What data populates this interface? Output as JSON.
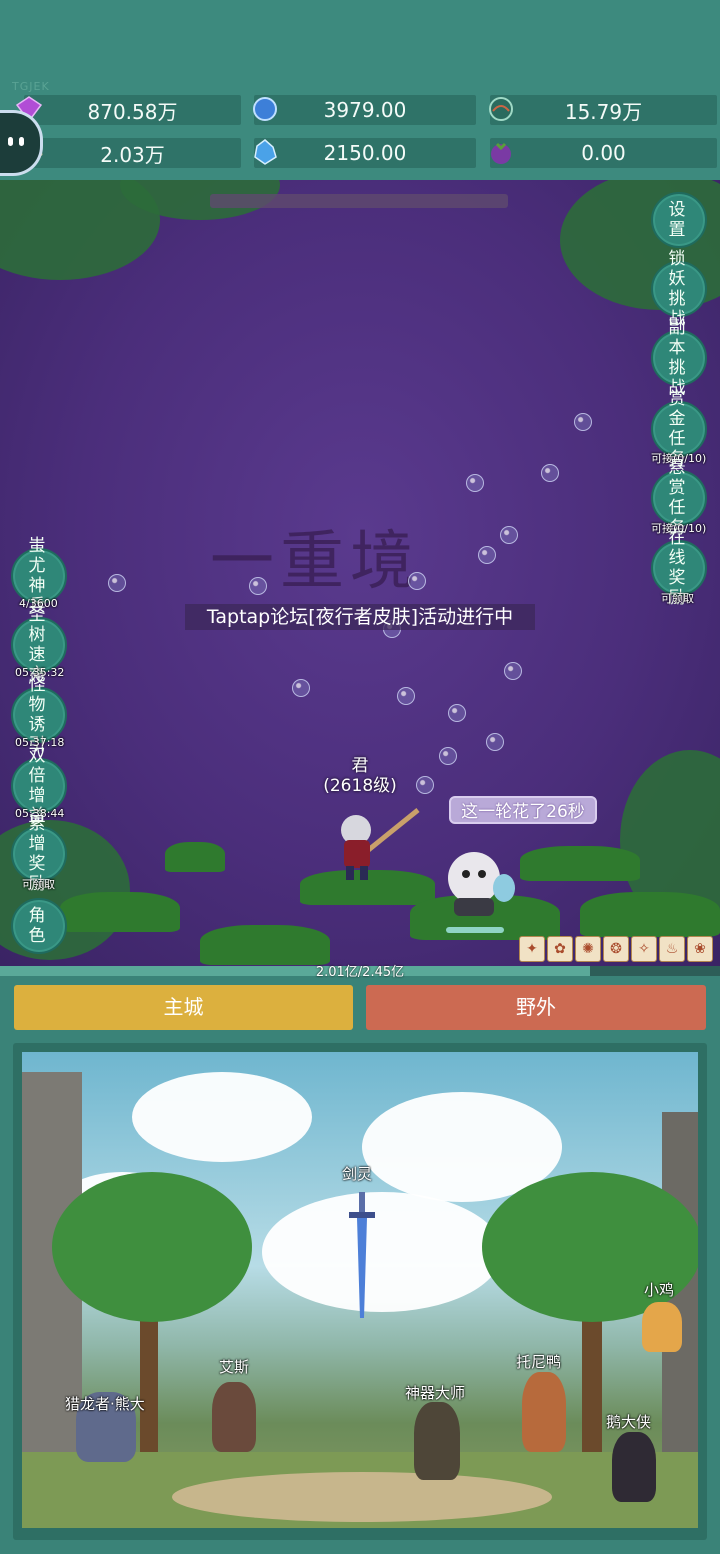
{
  "watermark": "TGJEK",
  "resources": [
    {
      "icon": "purple-gem-icon",
      "value": "870.58万"
    },
    {
      "icon": "blue-crystal-icon",
      "value": "3979.00"
    },
    {
      "icon": "orb-icon",
      "value": "15.79万"
    },
    {
      "icon": "scroll-icon",
      "value": "2.03万"
    },
    {
      "icon": "ice-crystal-icon",
      "value": "2150.00"
    },
    {
      "icon": "berry-icon",
      "value": "0.00"
    }
  ],
  "battle": {
    "background_text": "一重境",
    "announcement": "Taptap论坛[夜行者皮肤]活动进行中",
    "hero_name": "君",
    "hero_level": "(2618级)",
    "round_time": "这一轮花了26秒",
    "hp_text": "2.01亿/2.45亿",
    "hp_fraction": 0.82
  },
  "right_buttons": [
    {
      "label": "设置",
      "sub": ""
    },
    {
      "label": "锁妖挑战",
      "sub": ""
    },
    {
      "label": "副本挑战",
      "sub": ""
    },
    {
      "label": "赏金任务",
      "sub": "可接(0/10)"
    },
    {
      "label": "悬赏任务",
      "sub": "可接(0/10)"
    },
    {
      "label": "在线奖励",
      "sub": "可领取"
    }
  ],
  "left_buttons": [
    {
      "label": "蚩尤神兵",
      "sub": "4/3600"
    },
    {
      "label": "圣树速充",
      "sub": "05:35:32"
    },
    {
      "label": "怪物诱引",
      "sub": "05:37:18"
    },
    {
      "label": "双倍增益",
      "sub": "05:38:44"
    },
    {
      "label": "累增奖励",
      "sub": "可领取"
    },
    {
      "label": "角色",
      "sub": ""
    }
  ],
  "tabs": {
    "main_city": "主城",
    "wild": "野外"
  },
  "npcs": [
    "剑灵",
    "小鸡",
    "艾斯",
    "托尼鸭",
    "猎龙者·熊大",
    "神器大师",
    "鹅大侠"
  ],
  "colors": {
    "main_city_tab": "#dcb03e",
    "wild_tab": "#cc6a52",
    "teal": "#3a8378"
  }
}
